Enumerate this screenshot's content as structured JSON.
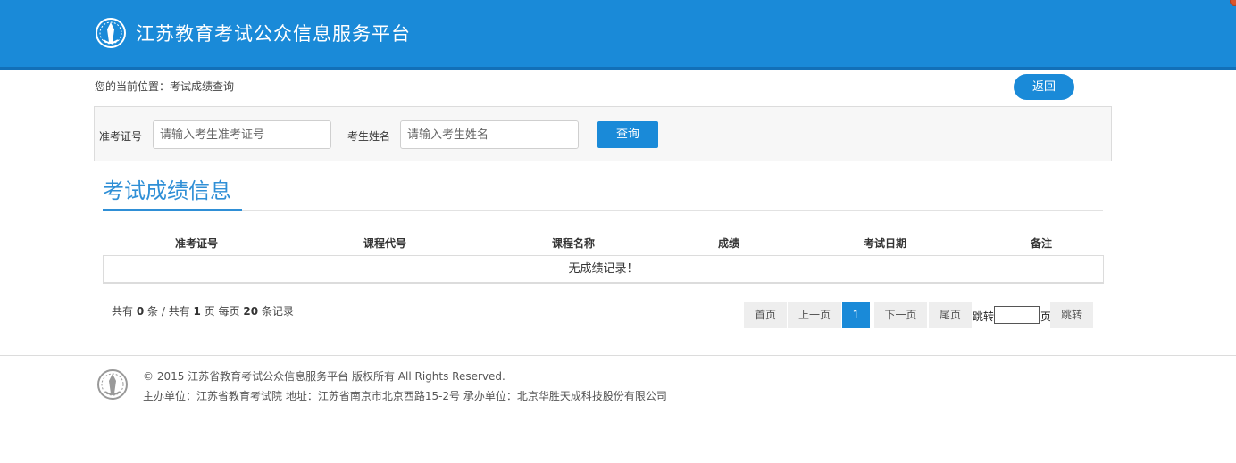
{
  "header": {
    "title": "江苏教育考试公众信息服务平台"
  },
  "breadcrumb": "您的当前位置：考试成绩查询",
  "back_button": "返回",
  "search": {
    "ticket_label": "准考证号",
    "ticket_placeholder": "请输入考生准考证号",
    "name_label": "考生姓名",
    "name_placeholder": "请输入考生姓名",
    "query_button": "查询"
  },
  "section_title": "考试成绩信息",
  "table": {
    "columns": [
      "准考证号",
      "课程代号",
      "课程名称",
      "成绩",
      "考试日期",
      "备注"
    ],
    "empty_message": "无成绩记录！"
  },
  "summary": {
    "prefix": "共有",
    "total": "0",
    "mid1": "条 / 共有",
    "pages": "1",
    "mid2": "页 每页",
    "per_page": "20",
    "suffix": "条记录"
  },
  "pagination": {
    "first": "首页",
    "prev": "上一页",
    "current": "1",
    "next": "下一页",
    "last": "尾页",
    "jump_prefix": "跳转",
    "jump_suffix": "页",
    "jump_button": "跳转"
  },
  "footer": {
    "copyright": "© 2015 江苏省教育考试公众信息服务平台 版权所有 All Rights Reserved.",
    "organizer": "主办单位：江苏省教育考试院 地址：江苏省南京市北京西路15-2号 承办单位：北京华胜天成科技股份有限公司"
  },
  "colors": {
    "brand_blue": "#1a8ad8",
    "title_blue": "#2f8fd6"
  }
}
